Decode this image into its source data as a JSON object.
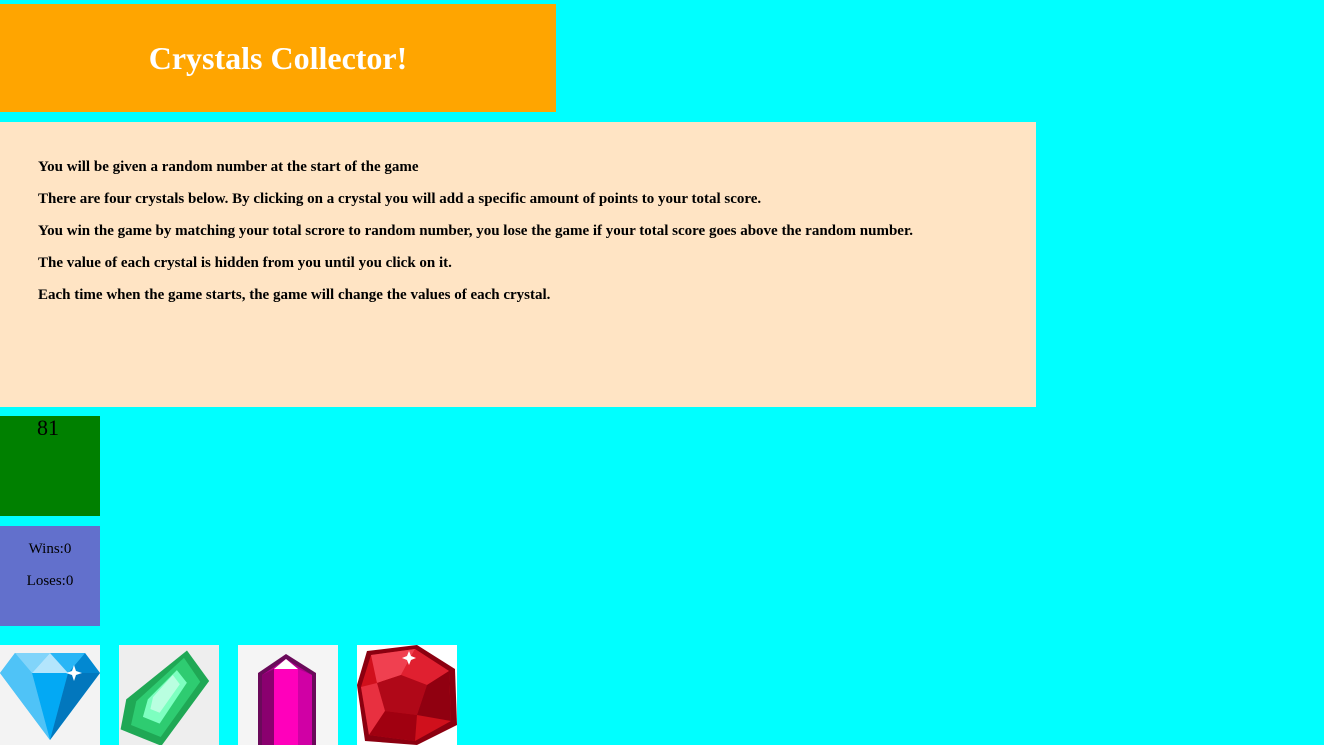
{
  "header": {
    "title": "Crystals Collector!"
  },
  "instructions": [
    "You will be given a random number at the start of the game",
    "There are four crystals below. By clicking on a crystal you will add a specific amount of points to your total score.",
    "You win the game by matching your total scrore to random number, you lose the game if your total score goes above the random number.",
    "The value of each crystal is hidden from you until you click on it.",
    "Each time when the game starts, the game will change the values of each crystal."
  ],
  "game": {
    "target_number": "81",
    "wins_label": "Wins:0",
    "loses_label": "Loses:0"
  },
  "crystals": [
    {
      "name": "blue-diamond-crystal-icon",
      "color": "#29b6f6"
    },
    {
      "name": "green-emerald-crystal-icon",
      "color": "#2ecc71"
    },
    {
      "name": "pink-gem-crystal-icon",
      "color": "#ff00bb"
    },
    {
      "name": "red-ruby-crystal-icon",
      "color": "#d0101c"
    }
  ],
  "colors": {
    "background": "#00ffff",
    "header": "#ffa500",
    "instructions": "#ffe4c4",
    "target_box": "#008000",
    "score_box": "#6270cc"
  }
}
